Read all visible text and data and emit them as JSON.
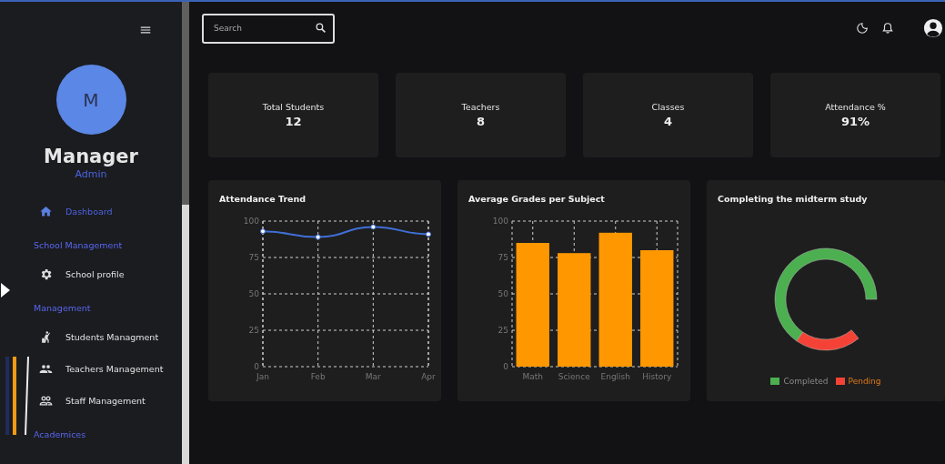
{
  "sidebar": {
    "profile": {
      "initial": "M",
      "name": "Manager",
      "role": "Admin"
    },
    "items": [
      {
        "kind": "link",
        "label": "Dashboard",
        "selected": true
      },
      {
        "kind": "section",
        "label": "School Management"
      },
      {
        "kind": "link",
        "label": "School profile",
        "selected": false
      },
      {
        "kind": "section",
        "label": "Management"
      },
      {
        "kind": "link",
        "label": "Students Managment",
        "selected": false
      },
      {
        "kind": "link",
        "label": "Teachers Management",
        "selected": false
      },
      {
        "kind": "link",
        "label": "Staff Management",
        "selected": false
      },
      {
        "kind": "section",
        "label": "Academices"
      }
    ]
  },
  "header": {
    "search": {
      "placeholder": "Search"
    }
  },
  "stats": [
    {
      "label": "Total Students",
      "value": "12"
    },
    {
      "label": "Teachers",
      "value": "8"
    },
    {
      "label": "Classes",
      "value": "4"
    },
    {
      "label": "Attendance %",
      "value": "91%"
    }
  ],
  "charts": [
    {
      "title": "Attendance Trend",
      "chart_data": {
        "type": "line",
        "grid": true,
        "categories": [
          "Jan",
          "Feb",
          "Mar",
          "Apr"
        ],
        "ylim": [
          0,
          100
        ],
        "yticks": [
          0,
          25,
          50,
          75,
          100
        ],
        "series": [
          {
            "color": "#3f6fd6",
            "marker": true,
            "values": [
              93,
              89,
              96,
              91
            ]
          }
        ]
      }
    },
    {
      "title": "Average Grades per Subject",
      "chart_data": {
        "type": "bar",
        "grid": true,
        "categories": [
          "Math",
          "Science",
          "English",
          "History"
        ],
        "ylim": [
          0,
          100
        ],
        "yticks": [
          0,
          25,
          50,
          75,
          100
        ],
        "series": [
          {
            "color": "#ff9800",
            "values": [
              85,
              78,
              92,
              80
            ]
          }
        ]
      }
    }
  ],
  "donut": {
    "title": "Completing the midterm study",
    "legend": [
      {
        "label": "Completed",
        "color": "#4caf50",
        "highlighted": false
      },
      {
        "label": "Pending",
        "color": "#f44336",
        "highlighted": true
      }
    ]
  }
}
